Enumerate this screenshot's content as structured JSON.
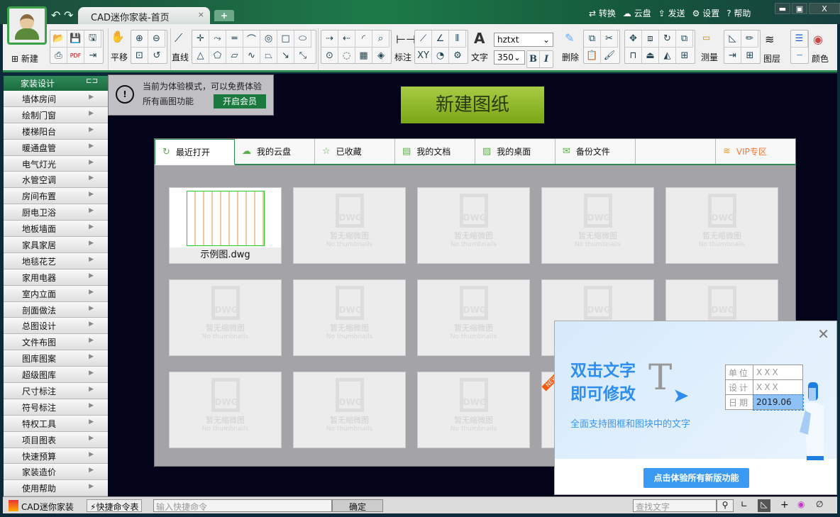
{
  "window": {
    "tab_title": "CAD迷你家装-首页",
    "close_tab": "×",
    "new_tab": "+",
    "links": [
      {
        "icon": "convert-icon",
        "glyph": "⇄",
        "label": "转换"
      },
      {
        "icon": "cloud-icon",
        "glyph": "☁",
        "label": "云盘"
      },
      {
        "icon": "send-icon",
        "glyph": "⇪",
        "label": "发送"
      },
      {
        "icon": "gear-icon",
        "glyph": "⚙",
        "label": "设置"
      },
      {
        "icon": "help-icon",
        "glyph": "?",
        "label": "帮助"
      }
    ],
    "minimize": "▬",
    "maximize": "▣",
    "close": "X"
  },
  "toolbar": {
    "new": "新建",
    "pan": "平移",
    "line": "直线",
    "dim": "标注",
    "text": "文字",
    "delete": "删除",
    "measure": "测量",
    "layer": "图层",
    "color": "颜色",
    "font": "hztxt",
    "size": "350",
    "bold": "B",
    "italic": "I"
  },
  "sidebar": {
    "title": "家装设计",
    "items": [
      "墙体房间",
      "绘制门窗",
      "楼梯阳台",
      "暖通盘管",
      "电气灯光",
      "水管空调",
      "房间布置",
      "厨电卫浴",
      "地板墙面",
      "家具家居",
      "地毯花艺",
      "家用电器",
      "室内立面",
      "剖面做法",
      "总图设计",
      "文件布图",
      "图库图案",
      "超级图库",
      "尺寸标注",
      "符号标注",
      "特权工具",
      "项目图表",
      "快速预算",
      "家装造价",
      "使用帮助"
    ]
  },
  "notice": {
    "line1": "当前为体验模式，可以免费体验",
    "line2": "所有画图功能",
    "button": "开启会员"
  },
  "new_drawing": "新建图纸",
  "tabs": [
    {
      "icon": "refresh-icon",
      "glyph": "↻",
      "label": "最近打开"
    },
    {
      "icon": "cloud-icon",
      "glyph": "☁",
      "label": "我的云盘"
    },
    {
      "icon": "star-icon",
      "glyph": "☆",
      "label": "已收藏"
    },
    {
      "icon": "document-icon",
      "glyph": "▤",
      "label": "我的文档"
    },
    {
      "icon": "desktop-icon",
      "glyph": "▨",
      "label": "我的桌面"
    },
    {
      "icon": "mail-icon",
      "glyph": "✉",
      "label": "备份文件"
    },
    {
      "icon": "vip-icon",
      "glyph": "≋",
      "label": "VIP专区"
    }
  ],
  "files": {
    "first": "示例图.dwg",
    "placeholder_zh": "暂无缩微图",
    "placeholder_en": "No thumbnails",
    "dwg": "DWG",
    "new_badge": "NEW"
  },
  "popup": {
    "title1": "双击文字",
    "title2": "即可修改",
    "subtitle": "全面支持图框和图块中的文字",
    "rows": [
      [
        "单位",
        "XXX"
      ],
      [
        "设计",
        "XXX"
      ],
      [
        "日期",
        "2019.06"
      ]
    ],
    "button": "点击体验所有新版功能",
    "close": "✕"
  },
  "status": {
    "app": "CAD迷你家装",
    "commands": "快捷命令表",
    "cmd_placeholder": "输入快捷命令",
    "ok": "确定",
    "search_placeholder": "查找文字"
  }
}
